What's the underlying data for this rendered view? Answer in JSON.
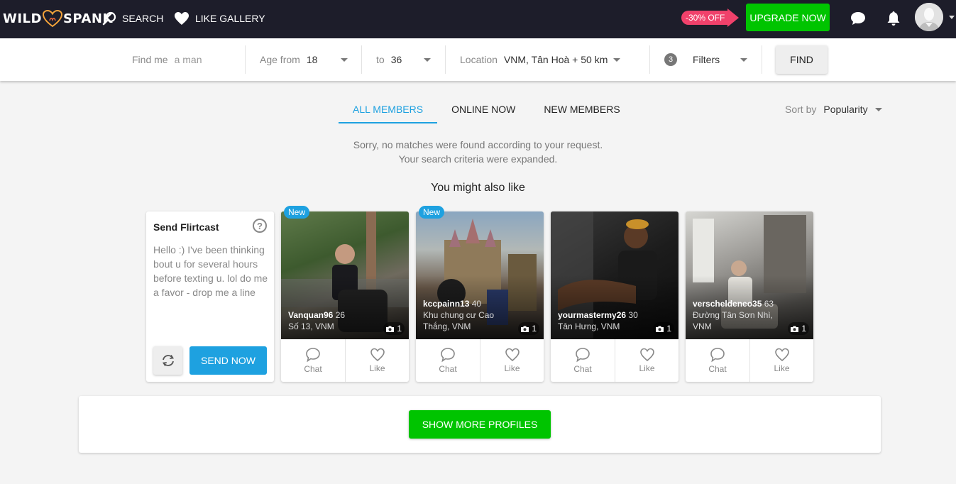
{
  "header": {
    "logo_left": "WILD",
    "logo_right": "SPANK",
    "nav": [
      {
        "label": "SEARCH",
        "icon": "search-icon"
      },
      {
        "label": "LIKE GALLERY",
        "icon": "heart-icon"
      }
    ],
    "discount_label": "-30% OFF",
    "upgrade_label": "UPGRADE NOW",
    "icons": [
      "chat-bubble-icon",
      "bell-icon",
      "avatar",
      "chevron-down-icon"
    ]
  },
  "search": {
    "find_me_label": "Find me",
    "find_me_value": "a man",
    "age_from_label": "Age from",
    "age_from_value": "18",
    "age_to_label": "to",
    "age_to_value": "36",
    "location_label": "Location",
    "location_value": "VNM, Tân Hoà + 50 km",
    "filters_count": "3",
    "filters_label": "Filters",
    "find_label": "FIND"
  },
  "tabs": [
    {
      "label": "ALL MEMBERS",
      "active": true
    },
    {
      "label": "ONLINE NOW",
      "active": false
    },
    {
      "label": "NEW MEMBERS",
      "active": false
    }
  ],
  "sort": {
    "label": "Sort by",
    "value": "Popularity"
  },
  "messages": {
    "no_match_line1": "Sorry, no matches were found according to your request.",
    "no_match_line2": "Your search criteria were expanded.",
    "you_might_like": "You might also like"
  },
  "flirtcast": {
    "title": "Send Flirtcast",
    "help": "?",
    "text": "Hello :) I've been thinking bout u for several hours before texting u. lol do me a favor - drop me a line",
    "send_label": "SEND NOW"
  },
  "profiles": [
    {
      "name": "Vanquan96",
      "age": "26",
      "location": "Số 13, VNM",
      "photos": "1",
      "new": "New",
      "chat": "Chat",
      "like": "Like"
    },
    {
      "name": "kccpainn13",
      "age": "40",
      "location": "Khu chung cư Cao Thắng, VNM",
      "photos": "1",
      "new": "New",
      "chat": "Chat",
      "like": "Like"
    },
    {
      "name": "yourmastermy26",
      "age": "30",
      "location": "Tân Hưng, VNM",
      "photos": "1",
      "new": null,
      "chat": "Chat",
      "like": "Like"
    },
    {
      "name": "verscheldeneo35",
      "age": "63",
      "location": "Đường Tân Sơn Nhì, VNM",
      "photos": "1",
      "new": null,
      "chat": "Chat",
      "like": "Like"
    }
  ],
  "show_more_label": "SHOW MORE PROFILES",
  "colors": {
    "topbar": "#1d1d2a",
    "accent_blue": "#1ea1e0",
    "green": "#00c400",
    "discount_pink": "#f0416b"
  }
}
